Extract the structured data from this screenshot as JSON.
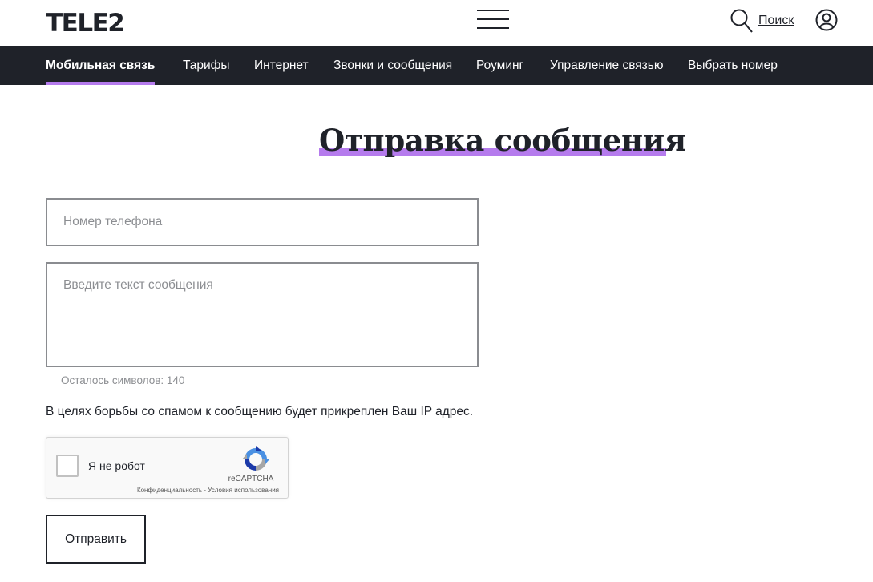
{
  "header": {
    "logo": "TELE2",
    "search_label": "Поиск"
  },
  "nav": {
    "items": [
      {
        "label": "Мобильная связь",
        "active": true
      },
      {
        "label": "Тарифы"
      },
      {
        "label": "Интернет"
      },
      {
        "label": "Звонки и сообщения"
      },
      {
        "label": "Роуминг"
      },
      {
        "label": "Управление связью"
      },
      {
        "label": "Выбрать номер"
      }
    ]
  },
  "page": {
    "title": "Отправка сообщения"
  },
  "form": {
    "phone_placeholder": "Номер телефона",
    "message_placeholder": "Введите текст сообщения",
    "counter": "Осталось символов: 140",
    "spam_note": "В целях борьбы со спамом к сообщению будет прикреплен Ваш IP адрес.",
    "submit_label": "Отправить"
  },
  "recaptcha": {
    "label": "Я не робот",
    "brand": "reCAPTCHA",
    "privacy": "Конфиденциальность",
    "separator": " - ",
    "terms": "Условия использования"
  },
  "colors": {
    "accent": "#b57bed",
    "nav_bg": "#1f2229",
    "text": "#1f2229",
    "muted": "#8c8e92"
  },
  "icons": {
    "menu": "hamburger-icon",
    "search": "search-icon",
    "profile": "user-circle-icon",
    "recaptcha": "recaptcha-logo-icon"
  }
}
